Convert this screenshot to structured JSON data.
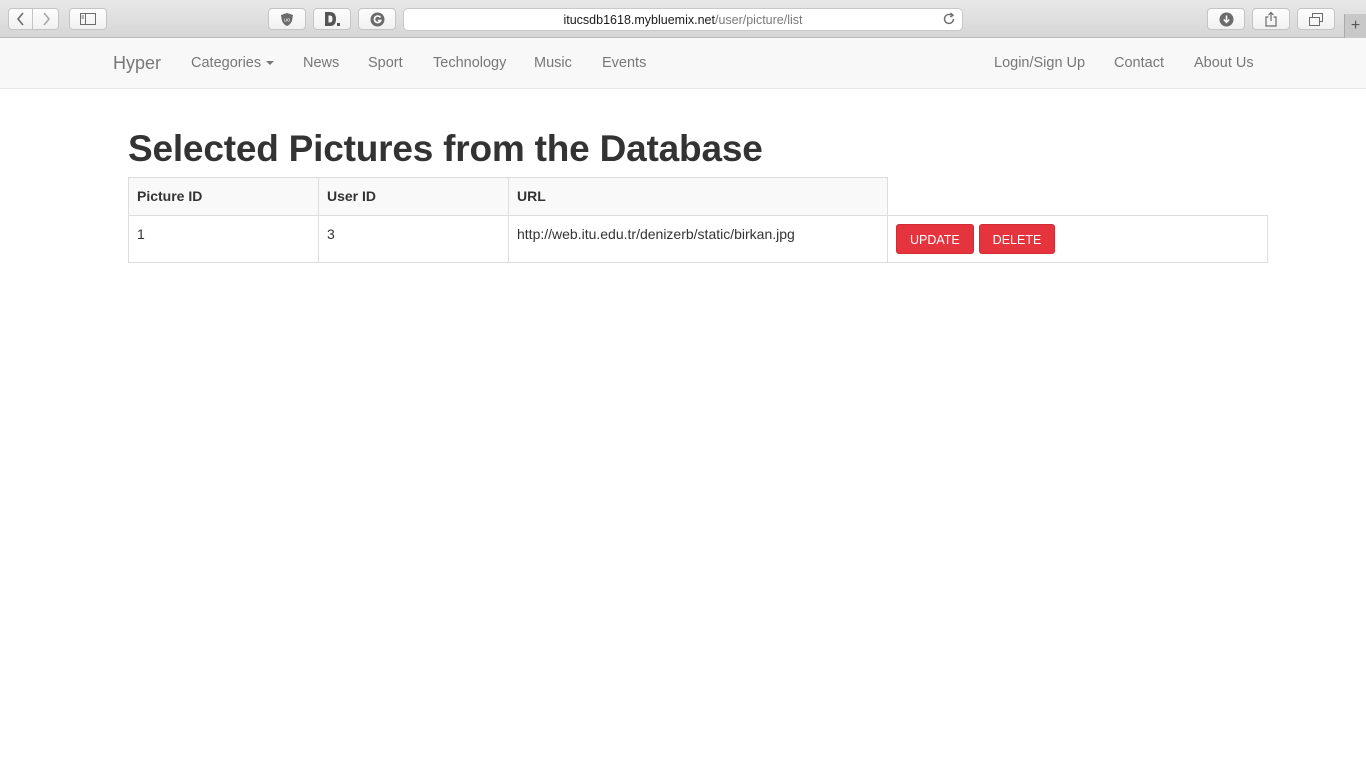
{
  "browser": {
    "url_domain": "itucsdb1618.mybluemix.net",
    "url_path": "/user/picture/list",
    "new_tab_label": "+"
  },
  "navbar": {
    "brand": "Hyper",
    "left_items": [
      {
        "label": "Categories",
        "dropdown": true
      },
      {
        "label": "News"
      },
      {
        "label": "Sport"
      },
      {
        "label": "Technology"
      },
      {
        "label": "Music"
      },
      {
        "label": "Events"
      }
    ],
    "right_items": [
      {
        "label": "Login/Sign Up"
      },
      {
        "label": "Contact"
      },
      {
        "label": "About Us"
      }
    ]
  },
  "main": {
    "title": "Selected Pictures from the Database",
    "table": {
      "headers": [
        "Picture ID",
        "User ID",
        "URL"
      ],
      "rows": [
        {
          "picture_id": "1",
          "user_id": "3",
          "url": "http://web.itu.edu.tr/denizerb/static/birkan.jpg",
          "update_label": "UPDATE",
          "delete_label": "DELETE"
        }
      ]
    }
  },
  "colors": {
    "danger": "#e6343e",
    "navbar_bg": "#f8f8f8",
    "nav_text": "#777777"
  }
}
